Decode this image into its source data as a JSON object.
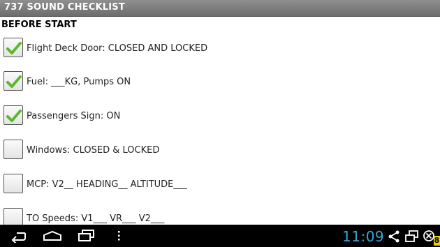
{
  "app": {
    "title": "737 SOUND CHECKLIST"
  },
  "section": {
    "title": "BEFORE START"
  },
  "checklist": {
    "items": [
      {
        "label": "Flight Deck Door: CLOSED AND LOCKED",
        "checked": true
      },
      {
        "label": "Fuel: ___KG, Pumps ON",
        "checked": true
      },
      {
        "label": "Passengers Sign: ON",
        "checked": true
      },
      {
        "label": "Windows: CLOSED & LOCKED",
        "checked": false
      },
      {
        "label": "MCP: V2__ HEADING__ ALTITUDE___",
        "checked": false
      },
      {
        "label": "TO Speeds: V1___ VR___ V2___",
        "checked": false
      }
    ]
  },
  "system_bar": {
    "time": "11:09",
    "badge": "8",
    "icons": [
      "back-icon",
      "home-icon",
      "recent-apps-icon",
      "menu-icon",
      "share-icon",
      "screens-icon",
      "close-icon"
    ]
  },
  "colors": {
    "titlebar": "#7a7a7a",
    "check": "#5cb82a",
    "clock": "#35a7d8",
    "badge": "#e7d400"
  }
}
